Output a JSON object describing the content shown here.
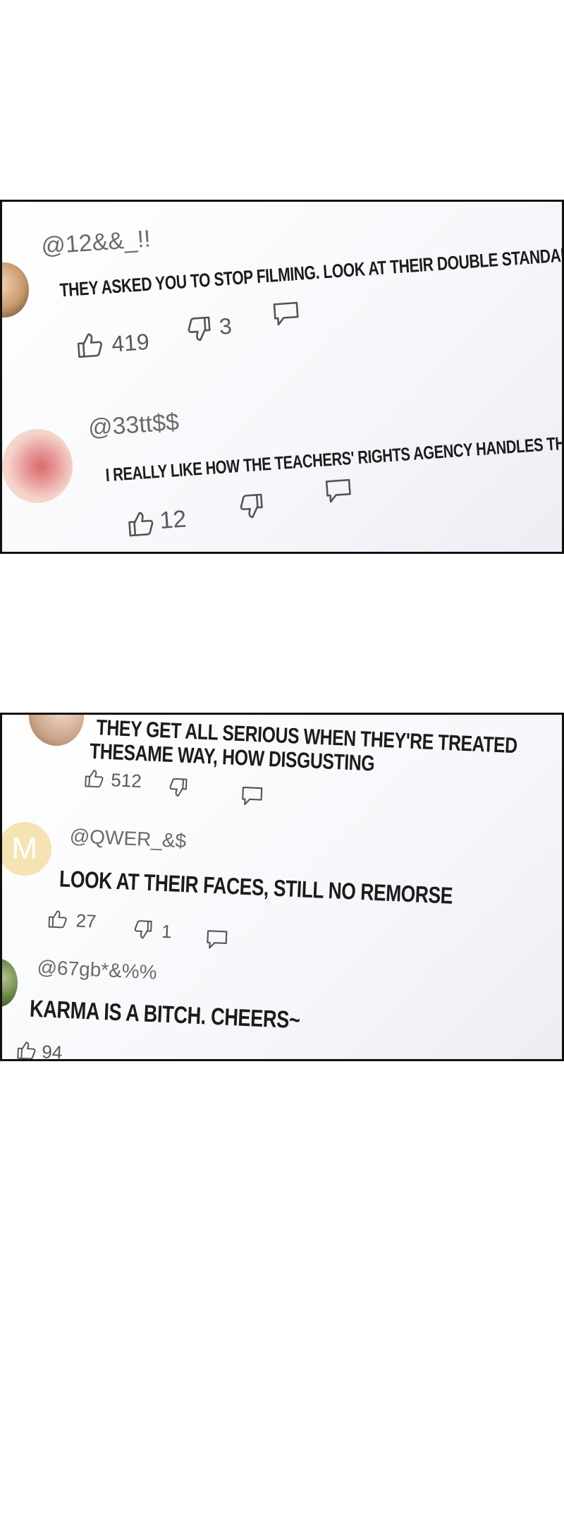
{
  "panels": [
    {
      "comments": [
        {
          "handle": "@12&&_!!",
          "text": "THEY ASKED YOU TO STOP FILMING. LOOK AT THEIR DOUBLE STANDARDS~ LOLOLO",
          "likes": "419",
          "dislikes": "3",
          "avatar": "illustrated face avatar"
        },
        {
          "handle": "@33tt$$",
          "text": "I REALLY LIKE HOW THE TEACHERS' RIGHTS AGENCY HANDLES THINGS~",
          "likes": "12",
          "avatar": "lips avatar"
        }
      ]
    },
    {
      "comments": [
        {
          "text_line1": "THEY GET ALL SERIOUS WHEN THEY'RE TREATED",
          "text_line2": "THESAME WAY, HOW DISGUSTING",
          "likes": "512",
          "avatar": "partial face avatar"
        },
        {
          "handle": "@QWER_&$",
          "text": "LOOK AT THEIR FACES, STILL NO REMORSE",
          "likes": "27",
          "dislikes": "1",
          "avatar_letter": "M"
        },
        {
          "handle": "@67gb*&%%",
          "text": "KARMA IS A BITCH. CHEERS~",
          "likes": "94",
          "avatar": "leaf avatar"
        }
      ]
    }
  ],
  "colors": {
    "border": "#111111",
    "avatar_m": "#f6e3b4",
    "text": "#1c1c1c",
    "muted": "#6b6b6b"
  },
  "icons": [
    "thumbs-up-icon",
    "thumbs-down-icon",
    "reply-icon"
  ]
}
